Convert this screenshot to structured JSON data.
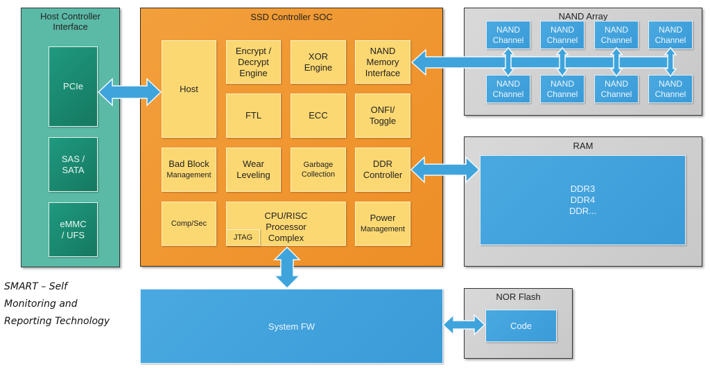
{
  "host_controller_interface": {
    "title": "Host Controller Interface",
    "items": [
      "PCIe",
      "SAS / SATA",
      "eMMC / UFS"
    ]
  },
  "soc": {
    "title": "SSD Controller SOC",
    "blocks": {
      "host": "Host",
      "encrypt": "Encrypt / Decrypt Engine",
      "xor": "XOR Engine",
      "nand_if": "NAND Memory Interface",
      "ftl": "FTL",
      "ecc": "ECC",
      "onfi": "ONFI/ Toggle",
      "bad_block_1": "Bad Block",
      "bad_block_2": "Management",
      "wear": "Wear Leveling",
      "garbage": "Garbage Collection",
      "ddr_ctrl": "DDR Controller",
      "compsec": "Comp/Sec",
      "cpu": "CPU/RISC Processor Complex",
      "jtag": "JTAG",
      "power_1": "Power",
      "power_2": "Management"
    }
  },
  "nand_array": {
    "title": "NAND Array",
    "channel_label": "NAND Channel",
    "channel_count": 8
  },
  "ram": {
    "title": "RAM",
    "lines": [
      "DDR3",
      "DDR4",
      "DDR..."
    ]
  },
  "nor_flash": {
    "title": "NOR Flash",
    "content": "Code"
  },
  "system_fw": {
    "label": "System FW"
  },
  "note": "SMART – Self\nMonitoring and\nReporting Technology",
  "colors": {
    "hci_panel": "#5bbaa6",
    "hci_box": "#1a8a70",
    "soc_panel": "#ef9530",
    "soc_block": "#fbd872",
    "gray_panel": "#cfcfcf",
    "blue_block": "#42a3dc",
    "arrow": "#3fa4dc"
  }
}
